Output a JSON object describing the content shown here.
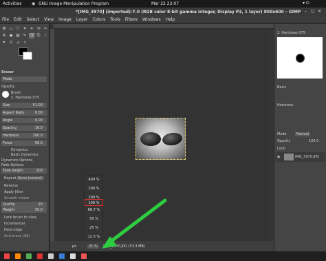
{
  "topbar": {
    "activities": "Activities",
    "app": "GNU Image Manipulation Program",
    "clock": "Mar 22  22:07"
  },
  "window": {
    "title": "*[IMG_3970] (imported)-7.0 (RGB color 8-bit gamma integer, Display P3, 1 layer) 800x600 – GIMP"
  },
  "menu": [
    "File",
    "Edit",
    "Select",
    "View",
    "Image",
    "Layer",
    "Colors",
    "Tools",
    "Filters",
    "Windows",
    "Help"
  ],
  "tool_options": {
    "tool_name": "Eraser",
    "opacity_label": "Opacity",
    "mode_label": "Mode",
    "brush_label": "Brush",
    "brush_name": "2. Hardness 075",
    "size_label": "Size",
    "size_value": "51.00",
    "aspect_label": "Aspect Ratio",
    "aspect_value": "0.00",
    "angle_label": "Angle",
    "angle_value": "0.00",
    "spacing_label": "Spacing",
    "spacing_value": "10.0",
    "hardness_label": "Hardness",
    "hardness_value": "100.0",
    "force_label": "Force",
    "force_value": "50.0",
    "dynamics_label": "Dynamics",
    "dynamics_value": "Basic Dynamics",
    "dynamics_options": "Dynamics Options",
    "fade_options": "Fade Options",
    "fade_length": "Fade length",
    "fade_length_value": "100",
    "repeat_label": "Repeat",
    "repeat_value": "None (extend)",
    "reverse": "Reverse",
    "apply_jitter": "Apply Jitter",
    "smooth_stroke": "Smooth stroke",
    "quality_label": "Quality",
    "quality_value": "20",
    "weight_label": "Weight",
    "weight_value": "50.0",
    "lock_brush": "Lock brush to view",
    "incremental": "Incremental",
    "hard_edge": "Hard edge",
    "anti_erase": "Anti erase (Alt)"
  },
  "zoom": {
    "options": [
      "400 %",
      "200 %",
      "100 %",
      "66.7 %",
      "50 %",
      "25 %",
      "12.5 %"
    ],
    "selected": "100 %",
    "current": "21 %",
    "unit": "px",
    "file_info": "IMG_3970.JPG (53.3 MB)"
  },
  "right_panel": {
    "brush_header": "2. Hardness 075",
    "basic": "Basic",
    "hardness_label": "Hardness",
    "mode_label": "Mode",
    "mode_value": "Normal",
    "opacity_label": "Opacity",
    "opacity_value": "100.0",
    "lock_label": "Lock:",
    "layer_name": "IMG_3970.JPG"
  },
  "colors": {
    "accent_arrow": "#2ecc40",
    "selected_highlight": "#e03030",
    "selection_border": "#e8d36a"
  }
}
